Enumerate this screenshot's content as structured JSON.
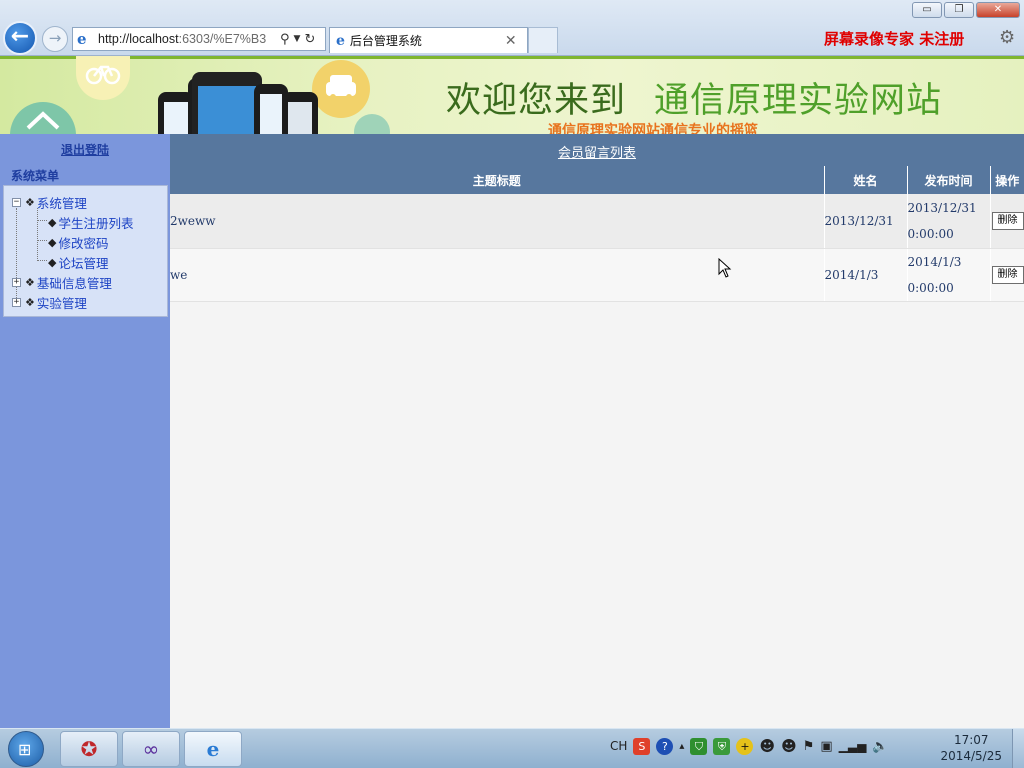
{
  "browser": {
    "url_main": "http://localhost",
    "url_rest": ":6303/%E7%B3",
    "tab_title": "后台管理系统",
    "watermark": "屏幕录像专家  未注册",
    "win_min": "▭",
    "win_max": "❐",
    "win_close": "✕"
  },
  "banner": {
    "title_left": "欢迎您来到",
    "title_right": "通信原理实验网站",
    "subtitle": "通信原理实验网站通信专业的摇篮"
  },
  "sidebar": {
    "logout": "退出登陆",
    "menu_title": "系统菜单",
    "tree": [
      {
        "label": "系统管理",
        "expander": "−",
        "children": [
          "学生注册列表",
          "修改密码",
          "论坛管理"
        ]
      },
      {
        "label": "基础信息管理",
        "expander": "+"
      },
      {
        "label": "实验管理",
        "expander": "+"
      }
    ]
  },
  "main": {
    "list_title": "会员留言列表",
    "columns": [
      "主题标题",
      "姓名",
      "发布时间",
      "操作"
    ],
    "rows": [
      {
        "title": "2weww",
        "name": "2013/12/31",
        "time_date": "2013/12/31",
        "time_clock": "0:00:00",
        "action": "删除"
      },
      {
        "title": "we",
        "name": "2014/1/3",
        "time_date": "2014/1/3",
        "time_clock": "0:00:00",
        "action": "删除"
      }
    ]
  },
  "taskbar": {
    "tray_lang": "CH",
    "clock_time": "17:07",
    "clock_date": "2014/5/25"
  },
  "colors": {
    "sidebar_bg": "#7b96dc",
    "header_bg": "#57779e",
    "banner_title": "#4fa02a",
    "watermark": "#e00000"
  }
}
